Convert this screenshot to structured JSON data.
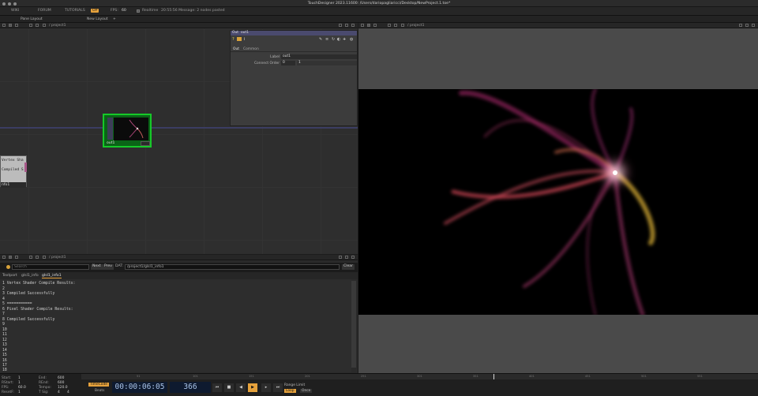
{
  "titlebar": {
    "title": "TouchDesigner 2023.11600: /Users/dariopagliaricci/Desktop/NewProject.1.toe*"
  },
  "menubar": {
    "items": [
      "WIKI",
      "FORUM",
      "TUTORIALS",
      "OP"
    ],
    "fps_label": "FPS:",
    "fps_value": "60",
    "realtime_label": "Realtime",
    "message": "20:55:56 Message: 2 nodes pasted"
  },
  "panebar": {
    "pane_layout": "Pane Layout",
    "new_layout": "New Layout",
    "plus": "+"
  },
  "network": {
    "path": "/ project1",
    "params": {
      "op_type": "Out",
      "op_name": "out1",
      "tabs": [
        "Out",
        "Common"
      ],
      "label_name": "Label",
      "label_value": "out1",
      "connect_order_name": "Connect Order",
      "connect_order_value": "0",
      "connect_order_value2": "1"
    },
    "out_node": {
      "name": "out1"
    },
    "info_node": {
      "line1": "Vertex Sha",
      "line2": "Compiled S",
      "name": "nfo1"
    }
  },
  "textport": {
    "path": "/ project1",
    "search_placeholder": "Search",
    "next": "Next",
    "prev": "Prev",
    "dat_label": "DAT:",
    "dat_value": "/project1/glsl1_info1",
    "clear": "Clear",
    "tabs": [
      "Textport",
      "glsl1_info",
      "glsl1_info1"
    ],
    "lines": [
      "1 Vertex Shader Compile Results:",
      "2",
      "3 Compiled Successfully",
      "4",
      "5 ===========",
      "6 Pixel Shader Compile Results:",
      "7",
      "8 Compiled Successfully",
      "9",
      "10",
      "11",
      "12",
      "13",
      "14",
      "15",
      "16",
      "17",
      "18"
    ]
  },
  "viewer": {
    "path": "/ project1"
  },
  "timeline": {
    "start_label": "Start:",
    "start": "1",
    "end_label": "End:",
    "end": "600",
    "rstart_label": "RStart:",
    "rstart": "1",
    "rend_label": "REnd:",
    "rend": "600",
    "fps_label": "FPS:",
    "fps": "60.0",
    "tempo_label": "Tempo:",
    "tempo": "120.0",
    "reset_label": "ResetF:",
    "reset": "1",
    "tsig_label": "T Sig:",
    "tsig_a": "4",
    "tsig_b": "4",
    "timecode_btn": "TimeCode",
    "beats_btn": "Beats",
    "timecode": "00:00:06:05",
    "frame": "366",
    "range_limit": "Range Limit",
    "loop": "Loop",
    "once": "Once",
    "ruler_ticks": [
      "51",
      "101",
      "151",
      "201",
      "251",
      "301",
      "351",
      "401",
      "451",
      "501",
      "551"
    ],
    "colors": {
      "accent": "#e6a23c",
      "timecode_bg": "#0e1a2f",
      "node_green": "#16c928"
    }
  }
}
